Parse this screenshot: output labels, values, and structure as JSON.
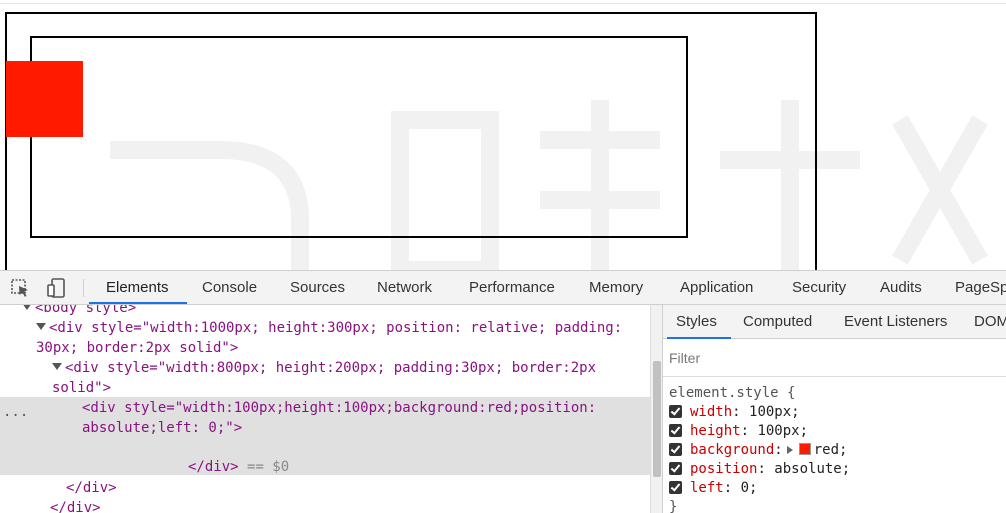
{
  "page": {
    "outer_box_color": "#000000",
    "red_box_color": "#ff1a00"
  },
  "devtools": {
    "toolbar": {
      "inspect_icon": "inspect-element-icon",
      "device_icon": "device-toolbar-icon",
      "tabs": [
        "Elements",
        "Console",
        "Sources",
        "Network",
        "Performance",
        "Memory",
        "Application",
        "Security",
        "Audits",
        "PageSp"
      ],
      "active_tab": "Elements"
    },
    "elements": {
      "body_line": "<body style>",
      "div1_open_a": "<div style=\"width:1000px; height:300px; position: relative; padding:",
      "div1_open_b": "30px; border:2px solid\">",
      "div2_open_a": "<div style=\"width:800px; height:200px; padding:30px; border:2px",
      "div2_open_b": "solid\">",
      "div3_a": "<div style=\"width:100px;height:100px;background:red;position:",
      "div3_b": "absolute;left: 0;\">",
      "div3_close": "</div>",
      "selected_marker": "== $0",
      "close1": "</div>",
      "close2": "</div>",
      "dots": "..."
    },
    "styles": {
      "tabs": [
        "Styles",
        "Computed",
        "Event Listeners",
        "DOM"
      ],
      "active_tab": "Styles",
      "filter_placeholder": "Filter",
      "selector": "element.style {",
      "properties": [
        {
          "name": "width",
          "value": "100px;"
        },
        {
          "name": "height",
          "value": "100px;"
        },
        {
          "name": "background",
          "value": "red;",
          "swatch": "#ff1a00"
        },
        {
          "name": "position",
          "value": "absolute;"
        },
        {
          "name": "left",
          "value": "0;"
        }
      ],
      "closing_brace": "}"
    }
  }
}
